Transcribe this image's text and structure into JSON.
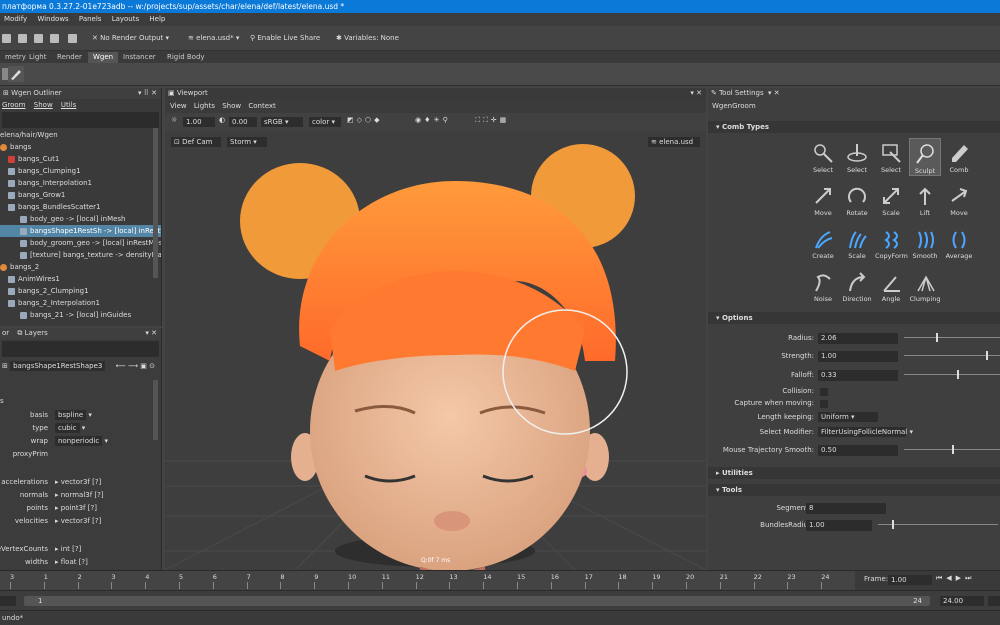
{
  "window": {
    "title": "платформа 0.3.27.2-01e723adb -- w:/projects/sup/assets/char/elena/def/latest/elena.usd *"
  },
  "menubar": [
    "Modify",
    "Windows",
    "Panels",
    "Layouts",
    "Help"
  ],
  "toolbar": {
    "render_output": "No Render Output",
    "file": "elena.usd*",
    "live_share": "Enable Live Share",
    "variables": "Variables: None"
  },
  "shelf_tabs": [
    "metry",
    "Light",
    "Render",
    "Wgen",
    "Instancer",
    "Rigid Body"
  ],
  "shelf_active": "Wgen",
  "outliner": {
    "title": "Wgen Outliner",
    "menu": [
      "Groom",
      "Show",
      "Utils"
    ],
    "path": "elena/hair/Wgen",
    "rows": [
      {
        "label": "bangs",
        "icon": "orange"
      },
      {
        "label": "bangs_Cut1",
        "icon": "red"
      },
      {
        "label": "bangs_Clumping1",
        "icon": "sq"
      },
      {
        "label": "bangs_Interpolation1",
        "icon": "sq"
      },
      {
        "label": "bangs_Grow1",
        "icon": "sq"
      },
      {
        "label": "bangs_BundlesScatter1",
        "icon": "sq"
      },
      {
        "label": "body_geo -> [local] inMesh",
        "icon": "sq"
      },
      {
        "label": "bangsShape1RestSh -> [local] inRestS...",
        "icon": "sq",
        "sel": true
      },
      {
        "label": "body_groom_geo -> [local] inRestMesh",
        "icon": "sq"
      },
      {
        "label": "[texture] bangs_texture -> densityMap",
        "icon": "sq"
      },
      {
        "label": "bangs_2",
        "icon": "orange"
      },
      {
        "label": "AnimWires1",
        "icon": "sq"
      },
      {
        "label": "bangs_2_Clumping1",
        "icon": "sq"
      },
      {
        "label": "bangs_2_Interpolation1",
        "icon": "sq"
      },
      {
        "label": "bangs_21 -> [local] inGuides",
        "icon": "sq"
      }
    ]
  },
  "attr_editor": {
    "tabs": [
      "or",
      "Layers"
    ],
    "node": "bangsShape1RestShape3",
    "rows": [
      {
        "label": "basis",
        "value": "bspline",
        "dropdown": true
      },
      {
        "label": "type",
        "value": "cubic",
        "dropdown": true
      },
      {
        "label": "wrap",
        "value": "nonperiodic",
        "dropdown": true
      },
      {
        "label": "proxyPrim",
        "value": ""
      },
      {
        "label": "accelerations",
        "value": "vector3f [?]"
      },
      {
        "label": "normals",
        "value": "normal3f [?]"
      },
      {
        "label": "points",
        "value": "point3f [?]"
      },
      {
        "label": "velocities",
        "value": "vector3f [?]"
      },
      {
        "label": "eVertexCounts",
        "value": "int [?]"
      },
      {
        "label": "widths",
        "value": "float [?]"
      }
    ],
    "section_s": "s"
  },
  "viewport": {
    "title": "Viewport",
    "menu": [
      "View",
      "Lights",
      "Show",
      "Context"
    ],
    "exposure": "1.00",
    "gamma": "0.00",
    "colorspace": "sRGB",
    "channel": "color",
    "camera": "Def Cam",
    "lighting": "Storm",
    "stage": "elena.usd",
    "hud_label": "Q:0f 7 ms"
  },
  "tool_settings": {
    "title": "Tool Settings",
    "tool": "WgenGroom",
    "comb_types_header": "Comb Types",
    "tools": [
      [
        "Select",
        "Select",
        "Select",
        "Sculpt",
        "Comb"
      ],
      [
        "Move",
        "Rotate",
        "Scale",
        "Lift",
        "Move"
      ],
      [
        "Create",
        "Scale",
        "CopyForm",
        "Smooth",
        "Average"
      ],
      [
        "Noise",
        "Direction",
        "Angle",
        "Clumping",
        ""
      ]
    ],
    "active_tool": "Sculpt",
    "options_header": "Options",
    "options": [
      {
        "label": "Radius:",
        "value": "2.06",
        "slider": 0.33
      },
      {
        "label": "Strength:",
        "value": "1.00",
        "slider": 0.85
      },
      {
        "label": "Falloff:",
        "value": "0.33",
        "slider": 0.55
      },
      {
        "label": "Collision:",
        "checkbox": true
      },
      {
        "label": "Capture when moving:",
        "checkbox": true
      },
      {
        "label": "Length keeping:",
        "value": "Uniform",
        "dropdown": true
      },
      {
        "label": "Select Modifier:",
        "value": "FilterUsingFollicleNormal",
        "dropdown": true
      },
      {
        "label": "Mouse Trajectory Smooth:",
        "value": "0.50",
        "slider": 0.5
      }
    ],
    "utilities_header": "Utilities",
    "tools_header": "Tools",
    "tools_opts": [
      {
        "label": "Segments:",
        "value": "8"
      },
      {
        "label": "BundlesRadius:",
        "value": "1.00"
      }
    ]
  },
  "timeline": {
    "ticks": [
      "3",
      "1",
      "2",
      "3",
      "4",
      "5",
      "6",
      "7",
      "8",
      "9",
      "10",
      "11",
      "12",
      "13",
      "14",
      "15",
      "16",
      "17",
      "18",
      "19",
      "20",
      "21",
      "22",
      "23",
      "24"
    ],
    "frame_label": "Frame:",
    "frame": "1.00"
  },
  "range": {
    "start": "1",
    "end": "24",
    "end_value": "24.00"
  },
  "cmdline": "undo*"
}
